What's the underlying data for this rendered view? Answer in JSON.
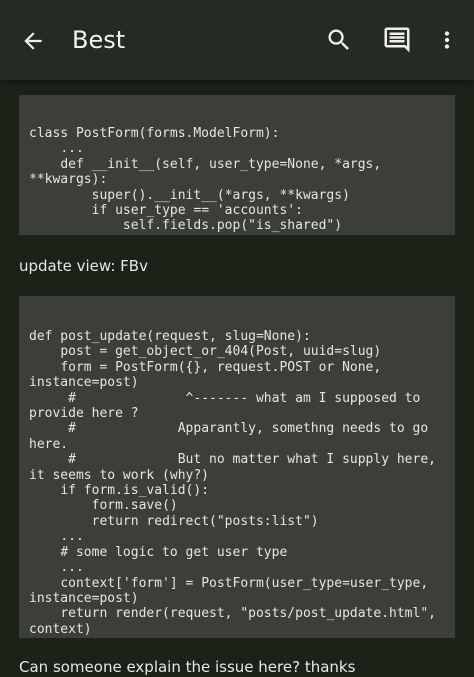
{
  "app_bar": {
    "title": "Best",
    "icons": {
      "back": "arrow-back-icon",
      "search": "search-icon",
      "comments": "comments-icon",
      "more": "more-vert-icon"
    }
  },
  "post": {
    "code_blocks": [
      {
        "lines": [
          "class PostForm(forms.ModelForm):",
          "    ...",
          "    def __init__(self, user_type=None, *args,",
          "**kwargs):",
          "        super().__init__(*args, **kwargs)",
          "        if user_type == 'accounts':",
          "            self.fields.pop(\"is_shared\")"
        ]
      },
      {
        "lines": [
          "def post_update(request, slug=None):",
          "    post = get_object_or_404(Post, uuid=slug)",
          "    form = PostForm({}, request.POST or None,",
          "instance=post)",
          "     #              ^------- what am I supposed to",
          "provide here ?",
          "     #             Apparantly, somethng needs to go",
          "here.",
          "     #             But no matter what I supply here,",
          "it seems to work (why?)",
          "    if form.is_valid():",
          "        form.save()",
          "        return redirect(\"posts:list\")",
          "    ...",
          "    # some logic to get user type",
          "    ...",
          "    context['form'] = PostForm(user_type=user_type,",
          "instance=post)",
          "    return render(request, \"posts/post_update.html\",",
          "context)"
        ]
      }
    ],
    "paragraphs": [
      "update view: FBv",
      "Can someone explain the issue here? thanks"
    ]
  },
  "colors": {
    "background": "#1c2218",
    "app_bar": "#252b22",
    "code_background": "#3c3f38",
    "text": "#e6e8e3"
  }
}
